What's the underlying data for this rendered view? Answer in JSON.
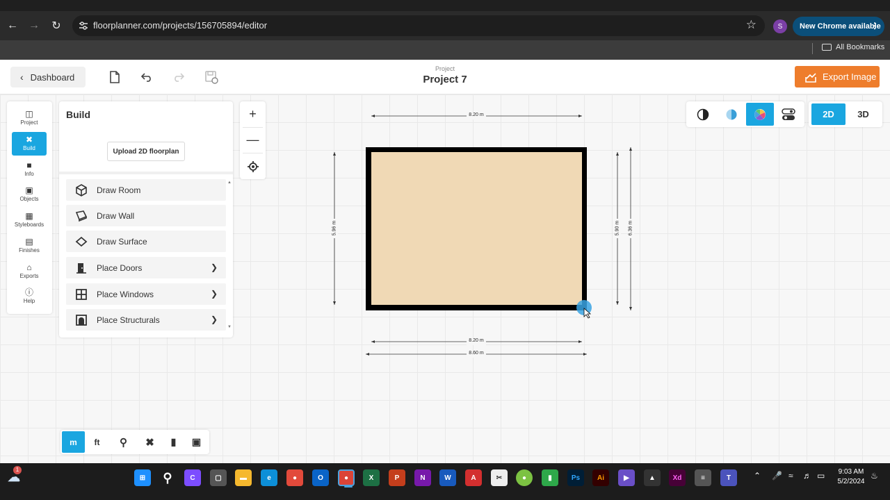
{
  "browser": {
    "url": "floorplanner.com/projects/156705894/editor",
    "profile_initial": "S",
    "update_label": "New Chrome available",
    "bookmarks_label": "All Bookmarks"
  },
  "header": {
    "dashboard_label": "Dashboard",
    "project_label": "Project",
    "project_name": "Project 7",
    "export_label": "Export Image"
  },
  "leftbar": {
    "items": [
      {
        "label": "Project",
        "icon": "project-icon"
      },
      {
        "label": "Build",
        "icon": "build-icon"
      },
      {
        "label": "Info",
        "icon": "info-icon"
      },
      {
        "label": "Objects",
        "icon": "objects-icon"
      },
      {
        "label": "Styleboards",
        "icon": "styleboards-icon"
      },
      {
        "label": "Finishes",
        "icon": "finishes-icon"
      },
      {
        "label": "Exports",
        "icon": "exports-icon"
      },
      {
        "label": "Help",
        "icon": "help-icon"
      }
    ],
    "active": "Build"
  },
  "build_panel": {
    "title": "Build",
    "upload_label": "Upload 2D floorplan",
    "items": [
      {
        "label": "Draw Room",
        "icon": "cube-icon",
        "has_submenu": false
      },
      {
        "label": "Draw Wall",
        "icon": "wall-icon",
        "has_submenu": false
      },
      {
        "label": "Draw Surface",
        "icon": "surface-icon",
        "has_submenu": false
      },
      {
        "label": "Place Doors",
        "icon": "door-icon",
        "has_submenu": true
      },
      {
        "label": "Place Windows",
        "icon": "window-icon",
        "has_submenu": true
      },
      {
        "label": "Place Structurals",
        "icon": "structural-icon",
        "has_submenu": true
      }
    ]
  },
  "view_modes": {
    "options": [
      "2D",
      "3D"
    ],
    "active": "2D"
  },
  "bottom_toolbar": {
    "unit_m": "m",
    "unit_ft": "ft",
    "active_unit": "m"
  },
  "floorplan": {
    "top_dimension": "8.20 m",
    "bottom_inner_dimension": "8.20 m",
    "bottom_outer_dimension": "8.60 m",
    "left_dimension": "5.96 m",
    "right_inner_dimension": "5.90 m",
    "right_outer_dimension": "6.36 m",
    "room_fill": "#f0d9b5",
    "wall_color": "#000000"
  },
  "taskbar": {
    "time": "9:03 AM",
    "date": "5/2/2024",
    "notification_count": "1"
  },
  "colors": {
    "accent": "#1aa6e0",
    "export": "#ee7d2c"
  }
}
